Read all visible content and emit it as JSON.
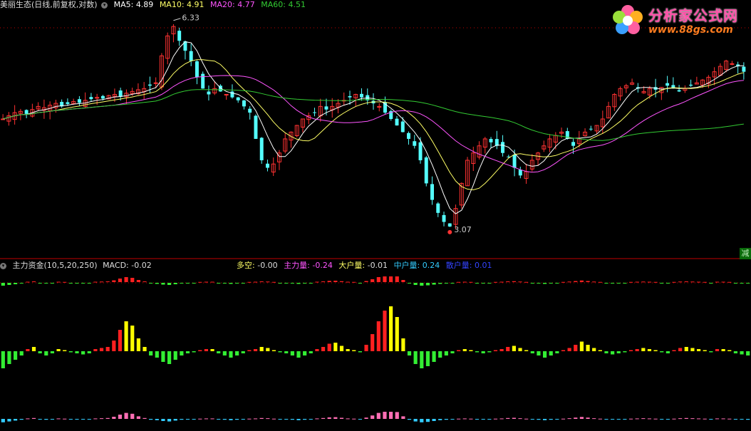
{
  "header": {
    "stock_name": "美丽生态(日线,前复权,对数)",
    "ma5_label": "MA5:",
    "ma5_value": "4.89",
    "ma10_label": "MA10:",
    "ma10_value": "4.91",
    "ma20_label": "MA20:",
    "ma20_value": "4.77",
    "ma60_label": "MA60:",
    "ma60_value": "4.51"
  },
  "indicator_header": {
    "name": "主力资金(10,5,20,250)",
    "macd_label": "MACD:",
    "macd_value": "-0.02",
    "duokong_label": "多空:",
    "duokong_value": "-0.00",
    "zhuli_label": "主力量:",
    "zhuli_value": "-0.24",
    "dahu_label": "大户量:",
    "dahu_value": "-0.01",
    "zhonghu_label": "中户量:",
    "zhonghu_value": "0.24",
    "sanhu_label": "散户量:",
    "sanhu_value": "0.01"
  },
  "logo": {
    "title": "分析家公式网",
    "url": "www.88gs.com"
  },
  "badge": {
    "text": "减"
  },
  "colors": {
    "background": "#000000",
    "up": "#ff3232",
    "down": "#54ffff",
    "ma5": "#ffffff",
    "ma10": "#ffff66",
    "ma20": "#ff55ff",
    "ma60": "#33cc33",
    "bar_red": "#ff2020",
    "bar_yellow": "#ffff00",
    "bar_green": "#33ee33",
    "bar_pink": "#ff6eb4",
    "bar_cyan": "#33ccff",
    "dotline": "#c00000"
  },
  "chart_data": [
    {
      "type": "candlestick",
      "title": "美丽生态(日线,前复权,对数)",
      "y_scale": "log",
      "ylim": [
        2.9,
        6.5
      ],
      "annotations": [
        {
          "label": "6.33",
          "type": "high"
        },
        {
          "label": "3.07",
          "type": "low"
        }
      ],
      "close_pattern": [
        4.5,
        4.55,
        4.6,
        4.62,
        4.58,
        4.65,
        4.7,
        4.68,
        4.72,
        4.75,
        4.7,
        4.74,
        4.78,
        4.76,
        4.8,
        4.82,
        4.85,
        4.83,
        4.88,
        4.9,
        4.86,
        4.92,
        4.95,
        4.98,
        5.0,
        5.05,
        5.1,
        5.6,
        6.0,
        6.2,
        5.9,
        5.7,
        5.5,
        5.2,
        5.0,
        4.9,
        5.0,
        4.95,
        4.9,
        4.85,
        4.8,
        4.7,
        4.6,
        4.2,
        3.9,
        3.8,
        3.85,
        4.0,
        4.2,
        4.3,
        4.4,
        4.5,
        4.55,
        4.6,
        4.7,
        4.65,
        4.7,
        4.75,
        4.8,
        4.85,
        4.9,
        4.85,
        4.8,
        4.75,
        4.7,
        4.6,
        4.5,
        4.4,
        4.3,
        4.2,
        4.1,
        3.9,
        3.6,
        3.4,
        3.25,
        3.15,
        3.1,
        3.3,
        3.6,
        3.9,
        4.0,
        4.1,
        4.2,
        4.15,
        4.1,
        4.0,
        3.95,
        3.8,
        3.7,
        3.75,
        3.9,
        4.0,
        4.1,
        4.2,
        4.25,
        4.3,
        4.2,
        4.1,
        4.2,
        4.3,
        4.35,
        4.4,
        4.5,
        4.7,
        4.9,
        5.0,
        5.05,
        5.1,
        5.0,
        4.95,
        5.0,
        4.98,
        5.02,
        5.05,
        5.0,
        4.95,
        5.0,
        5.05,
        5.1,
        5.15,
        5.2,
        5.3,
        5.4,
        5.5,
        5.45,
        5.4,
        5.3
      ],
      "series": [
        {
          "name": "MA5",
          "value": 4.89
        },
        {
          "name": "MA10",
          "value": 4.91
        },
        {
          "name": "MA20",
          "value": 4.77
        },
        {
          "name": "MA60",
          "value": 4.51
        }
      ]
    },
    {
      "type": "bar",
      "title": "主力资金(10,5,20,250)",
      "series": [
        {
          "name": "MACD",
          "value": -0.02
        },
        {
          "name": "多空",
          "value": -0.0
        },
        {
          "name": "主力量",
          "value": -0.24
        },
        {
          "name": "大户量",
          "value": -0.01
        },
        {
          "name": "中户量",
          "value": 0.24
        },
        {
          "name": "散户量",
          "value": 0.01
        }
      ],
      "hist_pattern": [
        -0.8,
        -0.6,
        -0.4,
        -0.2,
        0.1,
        0.2,
        -0.1,
        -0.2,
        -0.1,
        0.1,
        0.05,
        -0.05,
        -0.1,
        -0.15,
        -0.1,
        0.1,
        0.15,
        0.2,
        0.5,
        1.0,
        1.4,
        1.2,
        0.6,
        0.2,
        -0.2,
        -0.3,
        -0.5,
        -0.6,
        -0.4,
        -0.2,
        -0.1,
        -0.05,
        0.05,
        0.1,
        0.1,
        -0.1,
        -0.2,
        -0.3,
        -0.2,
        -0.1,
        0.05,
        0.1,
        0.2,
        0.15,
        0.05,
        -0.05,
        -0.1,
        -0.2,
        -0.3,
        -0.2,
        -0.1,
        0.1,
        0.2,
        0.35,
        0.4,
        0.25,
        0.1,
        0.05,
        -0.05,
        0.3,
        0.8,
        1.4,
        1.9,
        2.1,
        1.6,
        0.6,
        -0.2,
        -0.6,
        -0.8,
        -0.7,
        -0.5,
        -0.3,
        -0.2,
        -0.1,
        0.05,
        0.1,
        0.05,
        -0.05,
        -0.1,
        -0.05,
        0.05,
        0.1,
        0.2,
        0.25,
        0.15,
        0.05,
        -0.1,
        -0.2,
        -0.3,
        -0.2,
        -0.1,
        0.05,
        0.15,
        0.3,
        0.45,
        0.3,
        0.15,
        0.05,
        -0.1,
        -0.15,
        -0.1,
        -0.05,
        0.05,
        0.1,
        0.15,
        0.1,
        0.05,
        -0.05,
        -0.1,
        0.05,
        0.15,
        0.2,
        0.15,
        0.1,
        0.05,
        -0.05,
        0.1,
        0.1,
        0.05,
        -0.1,
        -0.15,
        -0.2
      ]
    }
  ]
}
